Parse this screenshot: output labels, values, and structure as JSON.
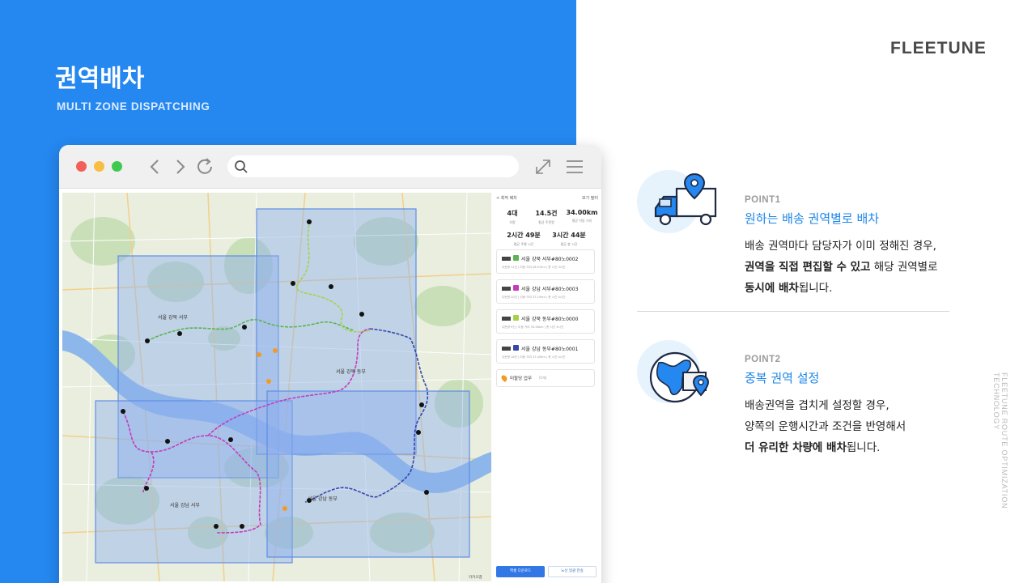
{
  "header": {
    "title": "권역배차",
    "subtitle": "MULTI ZONE DISPATCHING"
  },
  "brand": {
    "logo_text": "FLEETUNE",
    "vertical_tag": "FLEETUNE ROUTE OPTIMIZATION TECHNOLOGY"
  },
  "colors": {
    "brand_blue": "#2587f0",
    "accent_blue": "#1e86e8",
    "zone_fill": "#8fb0ee",
    "route_green": "#5ab552",
    "route_magenta": "#c33dbd",
    "route_navy": "#3648a8",
    "route_lime": "#a8d14a"
  },
  "browser": {
    "back_icon": "chevron-left-icon",
    "forward_icon": "chevron-right-icon",
    "reload_icon": "reload-icon",
    "search_icon": "search-icon",
    "expand_icon": "expand-icon",
    "menu_icon": "menu-icon"
  },
  "map": {
    "area_labels": [
      {
        "text": "서울 강북 서부"
      },
      {
        "text": "서울 강북 동부"
      },
      {
        "text": "서울 강남 서부"
      },
      {
        "text": "서울 강남 동부"
      }
    ],
    "attribution": "카카오맵"
  },
  "sidebar": {
    "back_label": "< 최적 배차",
    "filter_label": "보기 필터",
    "stats": [
      {
        "value": "4대",
        "label": "차량"
      },
      {
        "value": "14.5건",
        "label": "평균 주문량"
      },
      {
        "value": "34.00km",
        "label": "평균 이동 거리"
      }
    ],
    "stats2": [
      {
        "value": "2시간 49분",
        "label": "평균 주행 시간"
      },
      {
        "value": "3시간 44분",
        "label": "평균 총 시간"
      }
    ],
    "vehicles": [
      {
        "name": "서울 강북 서부#80노0002",
        "color": "#5ab552",
        "meta": "주문량 11건 | 이동 거리 28.57km | 총 시간 3시간"
      },
      {
        "name": "서울 강남 서부#80노0003",
        "color": "#c33dbd",
        "meta": "주문량 20건 | 이동 거리 37.19km | 총 시간 4시간"
      },
      {
        "name": "서울 강북 동부#80노0000",
        "color": "#a8d14a",
        "meta": "주문량 9건 | 이동 거리 33.58km | 총 시간 3시간"
      },
      {
        "name": "서울 강남 동부#80노0001",
        "color": "#3648a8",
        "meta": "주문량 18건 | 이동 거리 37.45km | 총 시간 4시간"
      }
    ],
    "unassigned_label": "미할당 업무",
    "unassigned_count": "(5개)",
    "primary_button": "엑셀 다운로드",
    "secondary_button": "노선 일괄 전송"
  },
  "points": [
    {
      "label": "POINT1",
      "title": "원하는 배송 권역별로 배차",
      "icon": "delivery-truck-icon",
      "line1": "배송 권역마다 담당자가 이미 정해진 경우,",
      "line2_bold": "권역을 직접 편집할 수 있고",
      "line2_rest": " 해당 권역별로",
      "line3_bold": "동시에 배차",
      "line3_rest": "됩니다."
    },
    {
      "label": "POINT2",
      "title": "중복 권역 설정",
      "icon": "globe-location-icon",
      "line1": "배송권역을 겹치게 설정할 경우,",
      "line2": "양쪽의 운행시간과 조건을 반영해서",
      "line3_bold": "더 유리한 차량에 배차",
      "line3_rest": "됩니다."
    }
  ]
}
